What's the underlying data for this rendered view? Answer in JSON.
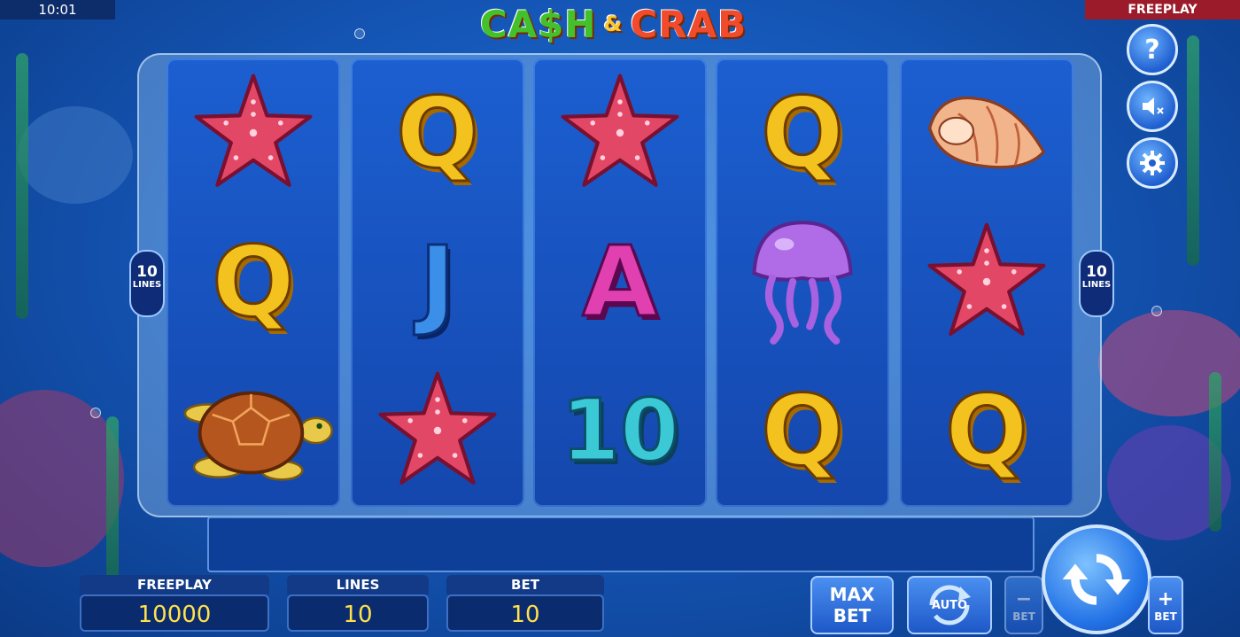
{
  "status_bar": {
    "time": "10:01",
    "mode": "FREEPLAY"
  },
  "logo": {
    "word1": "CA$H",
    "amp": "&",
    "word2": "CRAB"
  },
  "reels": [
    [
      "starfish",
      "Q",
      "turtle"
    ],
    [
      "Q",
      "J",
      "starfish"
    ],
    [
      "starfish",
      "A",
      "10"
    ],
    [
      "Q",
      "jellyfish",
      "Q"
    ],
    [
      "shell",
      "starfish",
      "Q"
    ]
  ],
  "letters": {
    "r1s2": "Q",
    "r2s1": "Q",
    "r2s2": "J",
    "r3s2": "A",
    "r3s3": "10",
    "r4s1": "Q",
    "r4s3": "Q",
    "r5s3": "Q"
  },
  "lines_badge": {
    "count": "10",
    "label": "LINES"
  },
  "side_buttons": {
    "help_glyph": "?"
  },
  "panels": {
    "freeplay": {
      "label": "FREEPLAY",
      "value": "10000"
    },
    "lines": {
      "label": "LINES",
      "value": "10"
    },
    "bet": {
      "label": "BET",
      "value": "10"
    }
  },
  "buttons": {
    "max_bet_line1": "MAX",
    "max_bet_line2": "BET",
    "auto": "AUTO",
    "bet_minus_sign": "−",
    "bet_minus_label": "BET",
    "bet_plus_sign": "+",
    "bet_plus_label": "BET"
  },
  "colors": {
    "accent": "#1f5fd0",
    "value_text": "#ffe14a",
    "freeplay_badge": "#9b1b2b"
  }
}
